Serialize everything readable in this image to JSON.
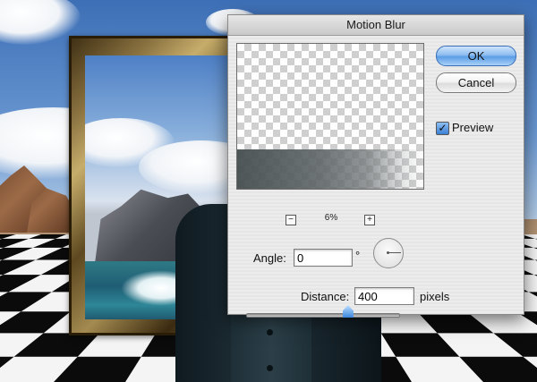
{
  "dialog": {
    "title": "Motion Blur",
    "ok_label": "OK",
    "cancel_label": "Cancel",
    "preview_label": "Preview",
    "preview_checked": true,
    "zoom_out_label": "−",
    "zoom_in_label": "+",
    "zoom_level": "6%",
    "angle_label": "Angle:",
    "angle_value": "0",
    "angle_unit": "°",
    "distance_label": "Distance:",
    "distance_value": "400",
    "distance_unit": "pixels",
    "distance_slider_fraction": 0.67
  },
  "colors": {
    "ok_button_blue": "#5c9de6",
    "dialog_background": "#ececec"
  }
}
